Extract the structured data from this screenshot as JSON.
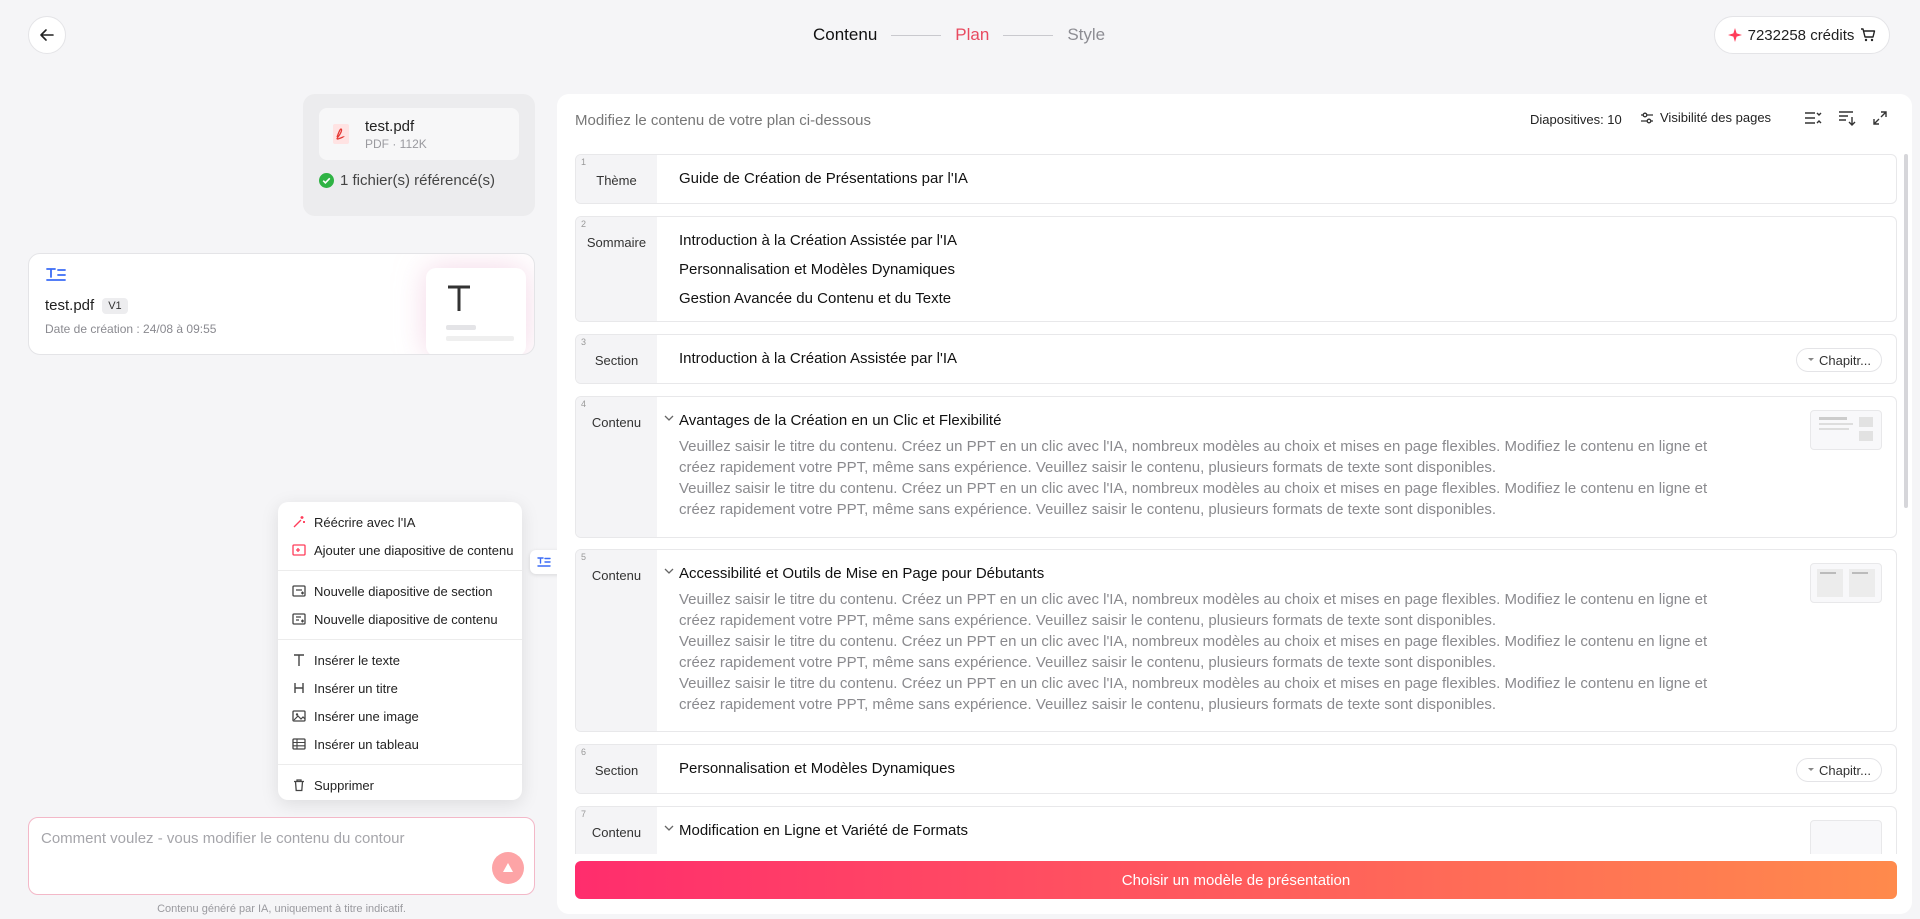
{
  "header": {
    "steps": [
      "Contenu",
      "Plan",
      "Style"
    ],
    "credits": "7232258 crédits"
  },
  "file": {
    "name": "test.pdf",
    "meta": "PDF · 112K",
    "referenced": "1 fichier(s) référencé(s)"
  },
  "document": {
    "name": "test.pdf",
    "version": "V1",
    "date": "Date de création : 24/08 à 09:55"
  },
  "menu": {
    "items": [
      "Réécrire avec l'IA",
      "Ajouter une diapositive de contenu",
      "Nouvelle diapositive de section",
      "Nouvelle diapositive de contenu",
      "Insérer le texte",
      "Insérer un titre",
      "Insérer une image",
      "Insérer un tableau",
      "Supprimer"
    ]
  },
  "prompt": {
    "placeholder": "Comment voulez - vous modifier le contenu du contour",
    "disclaimer": "Contenu généré par IA, uniquement à titre indicatif."
  },
  "panel": {
    "title": "Modifiez le contenu de votre plan ci-dessous",
    "slides": "Diapositives: 10",
    "visibility": "Visibilité des pages",
    "cta": "Choisir un modèle de présentation"
  },
  "rows": [
    {
      "num": "1",
      "label": "Thème",
      "title": "Guide de Création de Présentations par l'IA"
    },
    {
      "num": "2",
      "label": "Sommaire",
      "items": [
        "Introduction à la Création Assistée par l'IA",
        "Personnalisation et Modèles Dynamiques",
        "Gestion Avancée du Contenu et du Texte"
      ]
    },
    {
      "num": "3",
      "label": "Section",
      "title": "Introduction à la Création Assistée par l'IA",
      "chip": "Chapitr..."
    },
    {
      "num": "4",
      "label": "Contenu",
      "title": "Avantages de la Création en un Clic et Flexibilité",
      "paras": [
        "Veuillez saisir le titre du contenu. Créez un PPT en un clic avec l'IA, nombreux modèles au choix et mises en page flexibles. Modifiez le contenu en ligne et créez rapidement votre PPT, même sans expérience. Veuillez saisir le contenu, plusieurs formats de texte sont disponibles.",
        "Veuillez saisir le titre du contenu. Créez un PPT en un clic avec l'IA, nombreux modèles au choix et mises en page flexibles. Modifiez le contenu en ligne et créez rapidement votre PPT, même sans expérience. Veuillez saisir le contenu, plusieurs formats de texte sont disponibles."
      ]
    },
    {
      "num": "5",
      "label": "Contenu",
      "title": "Accessibilité et Outils de Mise en Page pour Débutants",
      "paras": [
        "Veuillez saisir le titre du contenu. Créez un PPT en un clic avec l'IA, nombreux modèles au choix et mises en page flexibles. Modifiez le contenu en ligne et créez rapidement votre PPT, même sans expérience. Veuillez saisir le contenu, plusieurs formats de texte sont disponibles.",
        "Veuillez saisir le titre du contenu. Créez un PPT en un clic avec l'IA, nombreux modèles au choix et mises en page flexibles. Modifiez le contenu en ligne et créez rapidement votre PPT, même sans expérience. Veuillez saisir le contenu, plusieurs formats de texte sont disponibles.",
        "Veuillez saisir le titre du contenu. Créez un PPT en un clic avec l'IA, nombreux modèles au choix et mises en page flexibles. Modifiez le contenu en ligne et créez rapidement votre PPT, même sans expérience. Veuillez saisir le contenu, plusieurs formats de texte sont disponibles."
      ]
    },
    {
      "num": "6",
      "label": "Section",
      "title": "Personnalisation et Modèles Dynamiques",
      "chip": "Chapitr..."
    },
    {
      "num": "7",
      "label": "Contenu",
      "title": "Modification en Ligne et Variété de Formats"
    }
  ],
  "colors": {
    "accent": "#e84a5f",
    "cta_start": "#ff2d6d",
    "cta_end": "#ff8a4c"
  }
}
